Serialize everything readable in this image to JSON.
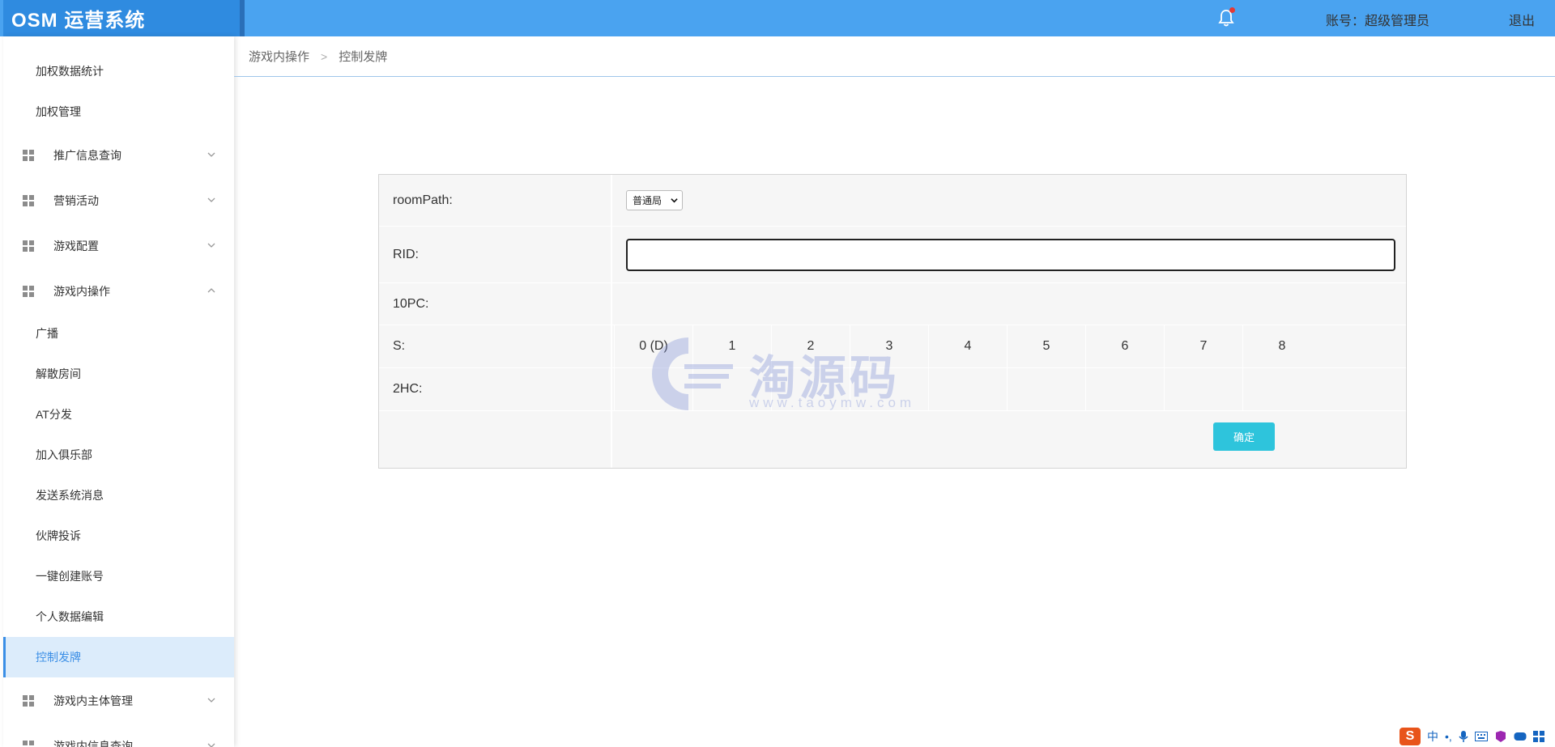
{
  "header": {
    "logo": "OSM 运营系统",
    "account": "账号：超级管理员",
    "logout": "退出"
  },
  "sidebar": {
    "items": [
      {
        "label": "加权数据统计",
        "kind": "sub"
      },
      {
        "label": "加权管理",
        "kind": "sub"
      },
      {
        "label": "推广信息查询",
        "kind": "group",
        "expanded": false
      },
      {
        "label": "营销活动",
        "kind": "group",
        "expanded": false
      },
      {
        "label": "游戏配置",
        "kind": "group",
        "expanded": false
      },
      {
        "label": "游戏内操作",
        "kind": "group",
        "expanded": true
      },
      {
        "label": "广播",
        "kind": "sub"
      },
      {
        "label": "解散房间",
        "kind": "sub"
      },
      {
        "label": "AT分发",
        "kind": "sub"
      },
      {
        "label": "加入俱乐部",
        "kind": "sub"
      },
      {
        "label": "发送系统消息",
        "kind": "sub"
      },
      {
        "label": "伙牌投诉",
        "kind": "sub"
      },
      {
        "label": "一键创建账号",
        "kind": "sub"
      },
      {
        "label": "个人数据编辑",
        "kind": "sub"
      },
      {
        "label": "控制发牌",
        "kind": "sub",
        "active": true
      },
      {
        "label": "游戏内主体管理",
        "kind": "group",
        "expanded": false
      },
      {
        "label": "游戏内信息查询",
        "kind": "group",
        "expanded": false
      }
    ]
  },
  "breadcrumb": {
    "parent": "游戏内操作",
    "separator": ">",
    "current": "控制发牌"
  },
  "form": {
    "room_path_label": "roomPath:",
    "room_path_value": "普通局",
    "rid_label": "RID:",
    "rid_value": "",
    "pc_label": "10PC:",
    "s_label": "S:",
    "s_columns": [
      "0 (D)",
      "1",
      "2",
      "3",
      "4",
      "5",
      "6",
      "7",
      "8"
    ],
    "hc_label": "2HC:",
    "confirm_label": "确定"
  },
  "watermark": {
    "text": "淘源码",
    "url": "www.taoymw.com"
  },
  "ime": {
    "logo": "S",
    "lang": "中"
  },
  "colors": {
    "header": "#4aa3f0",
    "accent": "#3a8ee6",
    "confirm": "#2ec4dc"
  }
}
